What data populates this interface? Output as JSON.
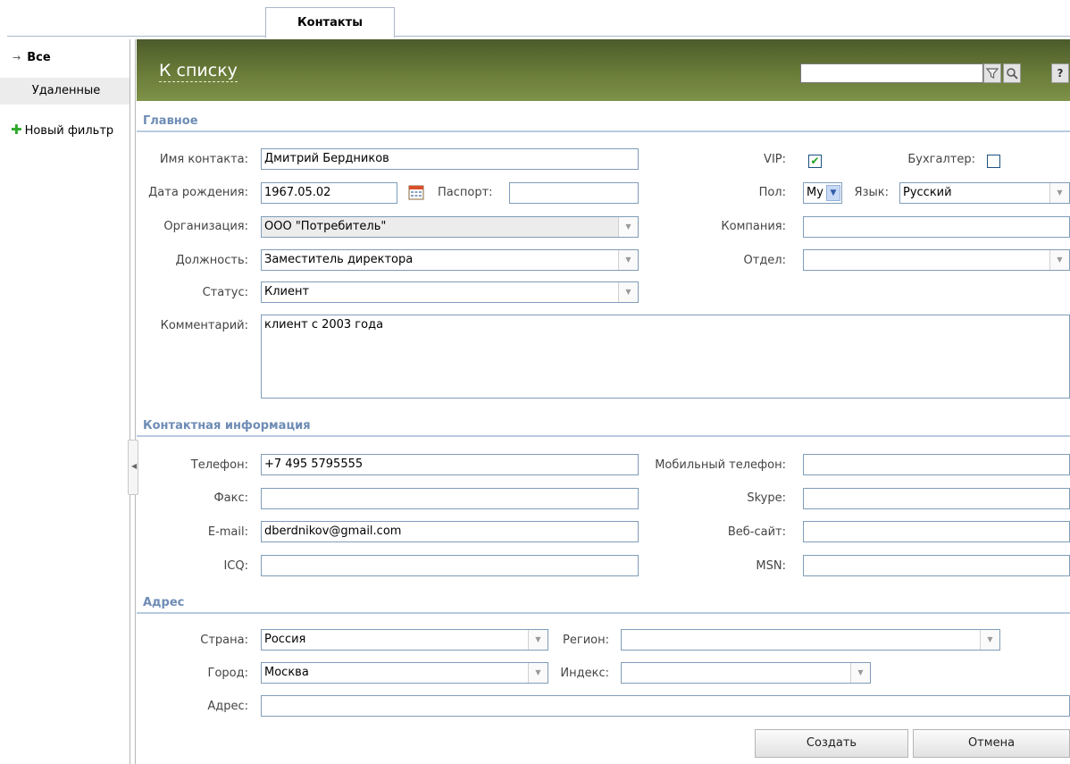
{
  "tabs": {
    "active": "Контакты"
  },
  "sidebar": {
    "all_label": "Все",
    "deleted_label": "Удаленные",
    "new_filter_label": "Новый фильтр"
  },
  "header": {
    "back_link": "К списку",
    "search_value": "",
    "help_label": "?"
  },
  "sections": {
    "main": "Главное",
    "contact": "Контактная информация",
    "address": "Адрес"
  },
  "main": {
    "name_label": "Имя контакта:",
    "name_value": "Дмитрий Бердников",
    "birth_label": "Дата рождения:",
    "birth_value": "1967.05.02",
    "passport_label": "Паспорт:",
    "passport_value": "",
    "org_label": "Организация:",
    "org_value": "ООО \"Потребитель\"",
    "position_label": "Должность:",
    "position_value": "Заместитель директора",
    "status_label": "Статус:",
    "status_value": "Клиент",
    "comment_label": "Комментарий:",
    "comment_value": "клиент с 2003 года",
    "vip_label": "VIP:",
    "vip_checked": true,
    "accountant_label": "Бухгалтер:",
    "accountant_checked": false,
    "gender_label": "Пол:",
    "gender_value": "Му",
    "language_label": "Язык:",
    "language_value": "Русский",
    "company_label": "Компания:",
    "company_value": "",
    "department_label": "Отдел:",
    "department_value": ""
  },
  "contact": {
    "phone_label": "Телефон:",
    "phone_value": "+7 495 5795555",
    "fax_label": "Факс:",
    "fax_value": "",
    "email_label": "E-mail:",
    "email_value": "dberdnikov@gmail.com",
    "icq_label": "ICQ:",
    "icq_value": "",
    "mobile_label": "Мобильный телефон:",
    "mobile_value": "",
    "skype_label": "Skype:",
    "skype_value": "",
    "website_label": "Веб-сайт:",
    "website_value": "",
    "msn_label": "MSN:",
    "msn_value": ""
  },
  "address": {
    "country_label": "Страна:",
    "country_value": "Россия",
    "region_label": "Регион:",
    "region_value": "",
    "city_label": "Город:",
    "city_value": "Москва",
    "index_label": "Индекс:",
    "index_value": "",
    "address_label": "Адрес:",
    "address_value": ""
  },
  "actions": {
    "create_label": "Создать",
    "cancel_label": "Отмена"
  },
  "colors": {
    "header_dark": "#4b5b2a",
    "header_light": "#7f9249",
    "section_title": "#6e8cb5",
    "field_border": "#7f9db9"
  }
}
